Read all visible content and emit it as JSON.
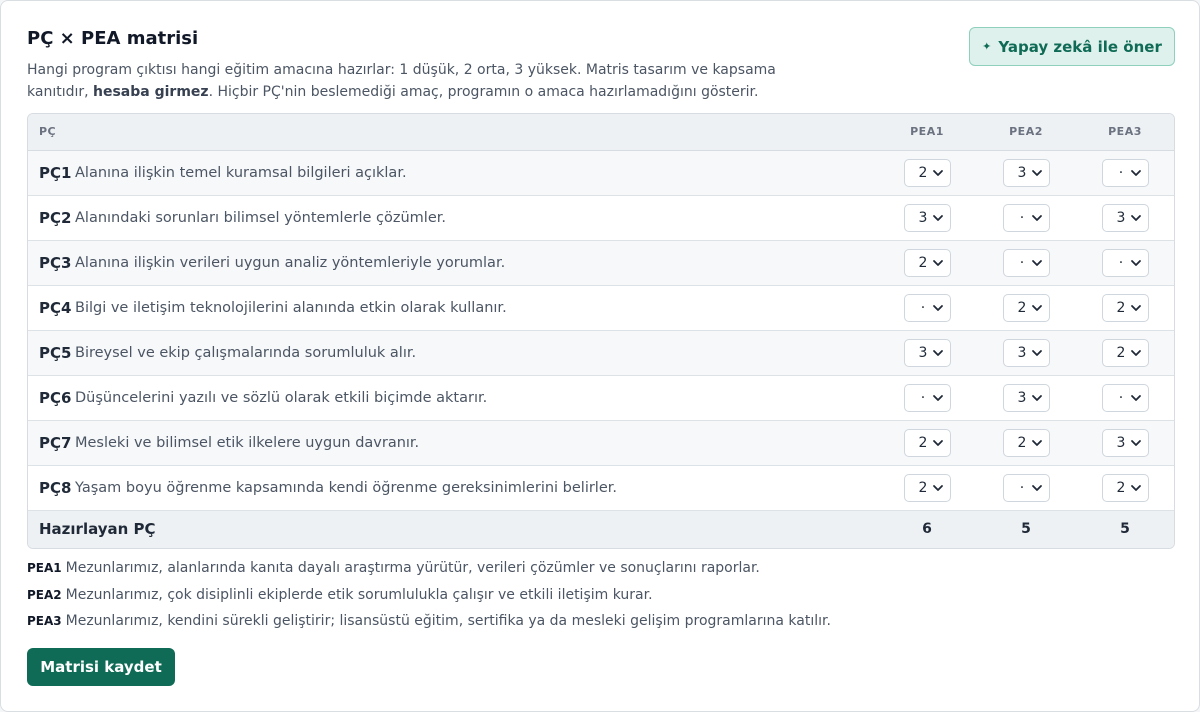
{
  "header": {
    "title": "PÇ × PEA matrisi",
    "desc_part1": "Hangi program çıktısı hangi eğitim amacına hazırlar: 1 düşük, 2 orta, 3 yüksek. Matris tasarım ve kapsama kanıtıdır, ",
    "desc_bold": "hesaba girmez",
    "desc_part2": ". Hiçbir PÇ'nin beslemediği amaç, programın o amaca hazırlamadığını gösterir.",
    "ai_button": "Yapay zekâ ile öner",
    "ai_icon": "sparkle-icon"
  },
  "table": {
    "col_pc": "PÇ",
    "columns": [
      "PEA1",
      "PEA2",
      "PEA3"
    ],
    "rows": [
      {
        "code": "PÇ1",
        "text": "Alanına ilişkin temel kuramsal bilgileri açıklar.",
        "values": [
          "2",
          "3",
          "·"
        ]
      },
      {
        "code": "PÇ2",
        "text": "Alanındaki sorunları bilimsel yöntemlerle çözümler.",
        "values": [
          "3",
          "·",
          "3"
        ]
      },
      {
        "code": "PÇ3",
        "text": "Alanına ilişkin verileri uygun analiz yöntemleriyle yorumlar.",
        "values": [
          "2",
          "·",
          "·"
        ]
      },
      {
        "code": "PÇ4",
        "text": "Bilgi ve iletişim teknolojilerini alanında etkin olarak kullanır.",
        "values": [
          "·",
          "2",
          "2"
        ]
      },
      {
        "code": "PÇ5",
        "text": "Bireysel ve ekip çalışmalarında sorumluluk alır.",
        "values": [
          "3",
          "3",
          "2"
        ]
      },
      {
        "code": "PÇ6",
        "text": "Düşüncelerini yazılı ve sözlü olarak etkili biçimde aktarır.",
        "values": [
          "·",
          "3",
          "·"
        ]
      },
      {
        "code": "PÇ7",
        "text": "Mesleki ve bilimsel etik ilkelere uygun davranır.",
        "values": [
          "2",
          "2",
          "3"
        ]
      },
      {
        "code": "PÇ8",
        "text": "Yaşam boyu öğrenme kapsamında kendi öğrenme gereksinimlerini belirler.",
        "values": [
          "2",
          "·",
          "2"
        ]
      }
    ],
    "footer_label": "Hazırlayan PÇ",
    "totals": [
      "6",
      "5",
      "5"
    ]
  },
  "definitions": [
    {
      "key": "PEA1",
      "text": "Mezunlarımız, alanlarında kanıta dayalı araştırma yürütür, verileri çözümler ve sonuçlarını raporlar."
    },
    {
      "key": "PEA2",
      "text": "Mezunlarımız, çok disiplinli ekiplerde etik sorumlulukla çalışır ve etkili iletişim kurar."
    },
    {
      "key": "PEA3",
      "text": "Mezunlarımız, kendini sürekli geliştirir; lisansüstü eğitim, sertifika ya da mesleki gelişim programlarına katılır."
    }
  ],
  "save_button": "Matrisi kaydet",
  "colors": {
    "accent": "#0f6b56",
    "ai_bg": "#dff1ec",
    "header_bg": "#eef1f4"
  }
}
